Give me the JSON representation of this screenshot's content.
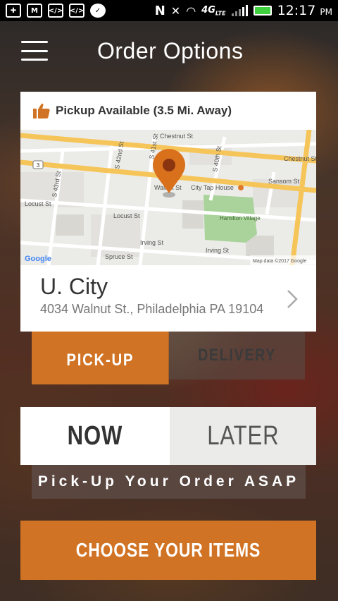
{
  "status_bar": {
    "time": "12:17",
    "ampm": "PM",
    "network": "4G",
    "network_sub": "LTE",
    "icons": [
      "plus-icon",
      "gmail-icon",
      "code-icon",
      "code-icon",
      "check-badge-icon",
      "nfc-icon",
      "mute-icon",
      "wifi-icon",
      "signal-icon",
      "battery-icon"
    ]
  },
  "header": {
    "title": "Order Options",
    "menu_icon": "hamburger-menu-icon"
  },
  "location_card": {
    "pickup_text": "Pickup Available (3.5 Mi. Away)",
    "name": "U. City",
    "address": "4034 Walnut St., Philadelphia PA 19104",
    "map": {
      "labels": {
        "chestnut": "Chestnut St",
        "s42nd": "S 42nd St",
        "s41st": "S 41st St",
        "s40th": "S 40th St",
        "s43rd": "S 43rd St",
        "walnut": "Walnut St",
        "city_tap": "City Tap House",
        "sansom": "Sansom St",
        "locust_left": "Locust St",
        "locust_mid": "Locust St",
        "hamilton": "Hamilton Village",
        "irving_left": "Irving St",
        "irving_right": "Irving St",
        "spruce": "Spruce St",
        "route": "3",
        "google": "Google",
        "map_data": "Map data ©2017 Google"
      }
    }
  },
  "order_type": {
    "pickup": "PICK-UP",
    "delivery": "DELIVERY"
  },
  "order_time": {
    "now": "NOW",
    "later": "LATER",
    "hint": "Pick-Up Your Order ASAP"
  },
  "cta": {
    "label": "CHOOSE YOUR ITEMS"
  },
  "colors": {
    "accent": "#d17324",
    "map_pin": "#d9701c",
    "map_road": "#f6c55a"
  }
}
